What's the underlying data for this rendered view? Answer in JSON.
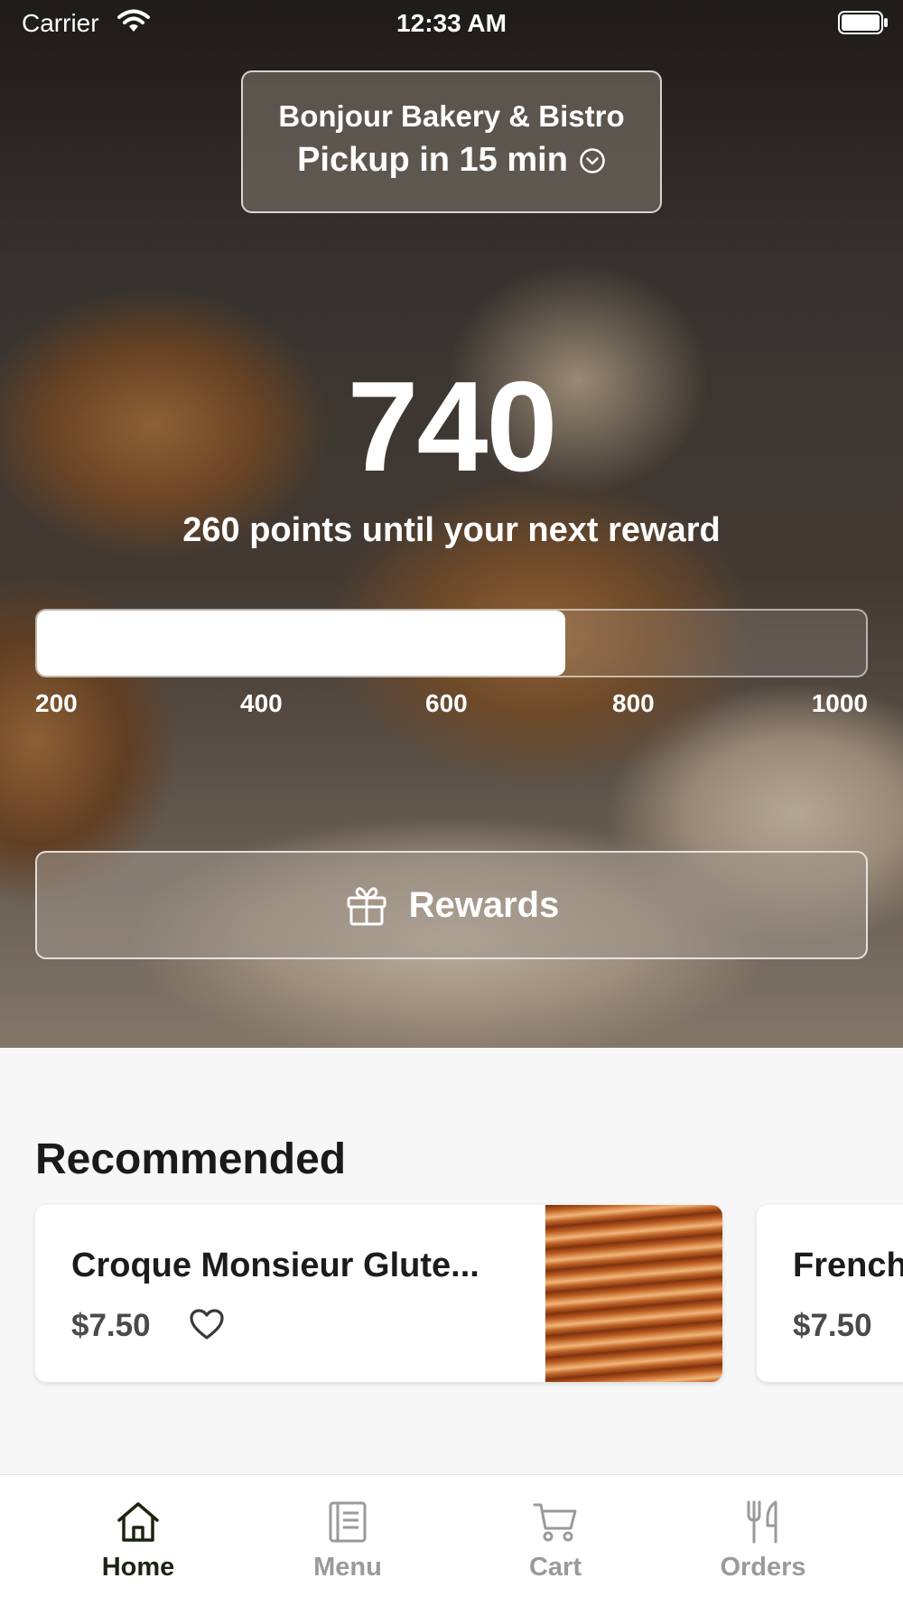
{
  "status_bar": {
    "carrier": "Carrier",
    "time": "12:33 AM"
  },
  "store": {
    "name": "Bonjour Bakery & Bistro",
    "pickup": "Pickup in 15 min",
    "icon": "chevron-down-circle-icon"
  },
  "rewards": {
    "points": "740",
    "caption": "260 points until your next reward",
    "progress_fraction": 0.6375,
    "ticks": [
      "200",
      "400",
      "600",
      "800",
      "1000"
    ],
    "button_label": "Rewards",
    "button_icon": "gift-icon"
  },
  "recommended": {
    "title": "Recommended",
    "items": [
      {
        "name": "Croque Monsieur Glute...",
        "price": "$7.50",
        "favorite_icon": "heart-outline-icon"
      },
      {
        "name": "French",
        "price": "$7.50"
      }
    ]
  },
  "tab_bar": {
    "tabs": [
      {
        "label": "Home",
        "icon": "home-icon",
        "active": true
      },
      {
        "label": "Menu",
        "icon": "menu-book-icon",
        "active": false
      },
      {
        "label": "Cart",
        "icon": "cart-icon",
        "active": false
      },
      {
        "label": "Orders",
        "icon": "fork-knife-icon",
        "active": false
      }
    ]
  },
  "colors": {
    "tab_active": "#1b2410",
    "tab_inactive": "#9a9a9a",
    "progress_fill": "#ffffff"
  }
}
